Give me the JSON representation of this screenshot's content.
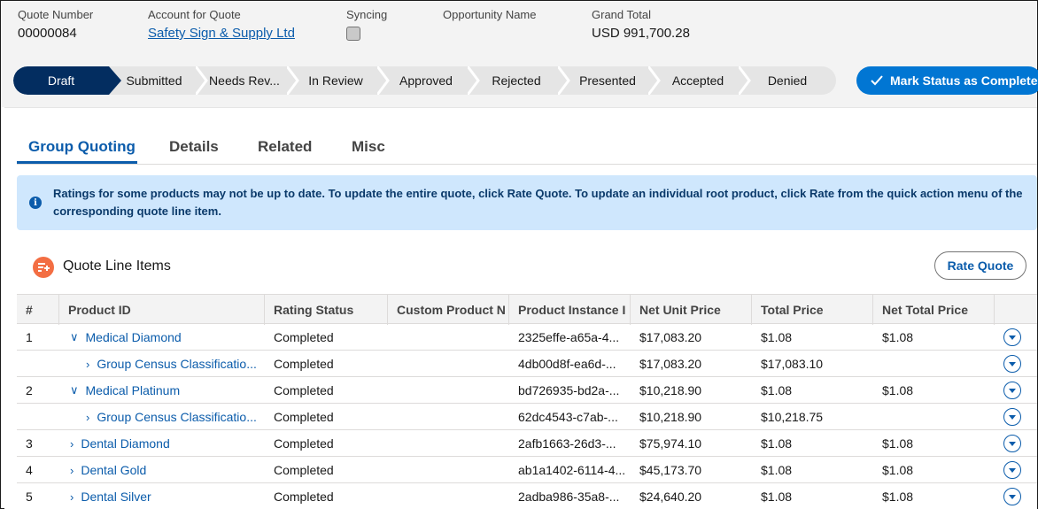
{
  "header": {
    "fields": [
      {
        "label": "Quote Number",
        "value": "00000084"
      },
      {
        "label": "Account for Quote",
        "value": "Safety Sign & Supply Ltd"
      },
      {
        "label": "Syncing",
        "value": ""
      },
      {
        "label": "Opportunity Name",
        "value": ""
      },
      {
        "label": "Grand Total",
        "value": "USD 991,700.28"
      }
    ]
  },
  "path": {
    "stages": [
      "Draft",
      "Submitted",
      "Needs Rev...",
      "In Review",
      "Approved",
      "Rejected",
      "Presented",
      "Accepted",
      "Denied"
    ],
    "active": "Draft",
    "complete_button": "Mark Status as Complete",
    "complete_icon": "checkmark-icon"
  },
  "tabs": [
    "Group Quoting",
    "Details",
    "Related",
    "Misc"
  ],
  "alert": {
    "icon": "info-icon",
    "text": "Ratings for some products may not be up to date. To update the entire quote, click Rate Quote. To update an individual root product, click Rate from the quick action menu of the corresponding quote line item."
  },
  "line_items": {
    "title": "Quote Line Items",
    "icon": "quote-line-items-icon",
    "rate_button": "Rate Quote",
    "columns": [
      "#",
      "Product ID",
      "Rating Status",
      "Custom Product N",
      "Product Instance I",
      "Net Unit Price",
      "Total Price",
      "Net Total Price"
    ],
    "rows": [
      {
        "num": "1",
        "toggle": "expanded",
        "level": 0,
        "product": "Medical Diamond",
        "status": "Completed",
        "custom": "",
        "instance": "2325effe-a65a-4...",
        "net_unit": "$17,083.20",
        "total": "$1.08",
        "net_total": "$1.08"
      },
      {
        "num": "",
        "toggle": "collapsed",
        "level": 1,
        "product": "Group Census Classificatio...",
        "status": "Completed",
        "custom": "",
        "instance": "4db00d8f-ea6d-...",
        "net_unit": "$17,083.20",
        "total": "$17,083.10",
        "net_total": ""
      },
      {
        "num": "2",
        "toggle": "expanded",
        "level": 0,
        "product": "Medical Platinum",
        "status": "Completed",
        "custom": "",
        "instance": "bd726935-bd2a-...",
        "net_unit": "$10,218.90",
        "total": "$1.08",
        "net_total": "$1.08"
      },
      {
        "num": "",
        "toggle": "collapsed",
        "level": 1,
        "product": "Group Census Classificatio...",
        "status": "Completed",
        "custom": "",
        "instance": "62dc4543-c7ab-...",
        "net_unit": "$10,218.90",
        "total": "$10,218.75",
        "net_total": ""
      },
      {
        "num": "3",
        "toggle": "collapsed",
        "level": 0,
        "product": "Dental Diamond",
        "status": "Completed",
        "custom": "",
        "instance": "2afb1663-26d3-...",
        "net_unit": "$75,974.10",
        "total": "$1.08",
        "net_total": "$1.08"
      },
      {
        "num": "4",
        "toggle": "collapsed",
        "level": 0,
        "product": "Dental Gold",
        "status": "Completed",
        "custom": "",
        "instance": "ab1a1402-6114-4...",
        "net_unit": "$45,173.70",
        "total": "$1.08",
        "net_total": "$1.08"
      },
      {
        "num": "5",
        "toggle": "collapsed",
        "level": 0,
        "product": "Dental Silver",
        "status": "Completed",
        "custom": "",
        "instance": "2adba986-35a8-...",
        "net_unit": "$24,640.20",
        "total": "$1.08",
        "net_total": "$1.08"
      }
    ]
  }
}
